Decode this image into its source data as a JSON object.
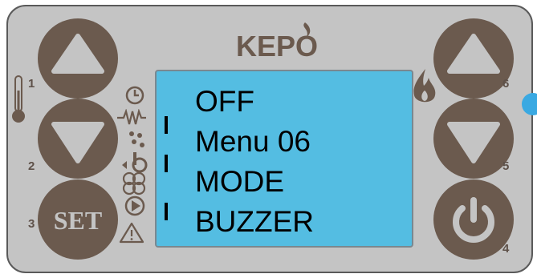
{
  "brand": {
    "name": "KEPO"
  },
  "colors": {
    "panel": "#c4c4c4",
    "button": "#6b5a4e",
    "lcd": "#54bde2",
    "led": "#3aa9e2",
    "number": "#5e5149"
  },
  "lcd": {
    "lines": [
      "OFF",
      "Menu 06",
      "MODE",
      "BUZZER"
    ]
  },
  "buttons": {
    "b1": {
      "number": "1",
      "icon": "up-arrow"
    },
    "b2": {
      "number": "2",
      "icon": "down-arrow"
    },
    "b3": {
      "number": "3",
      "label": "SET"
    },
    "b4": {
      "number": "4",
      "icon": "power"
    },
    "b5": {
      "number": "5",
      "icon": "down-arrow"
    },
    "b6": {
      "number": "6",
      "icon": "up-arrow"
    }
  },
  "indicators": [
    "clock-icon",
    "resistor-icon",
    "pellet-icon",
    "auger-icon",
    "fan-icon",
    "play-icon",
    "warning-icon",
    "thermometer-icon",
    "flame-icon"
  ]
}
